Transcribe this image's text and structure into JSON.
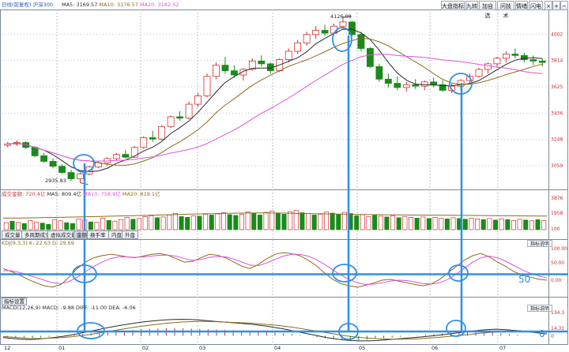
{
  "toolbar": {
    "title_prefix": "日线(前复权)",
    "code": "沪深300",
    "buttons": [
      "大盘指标",
      "九转",
      "加自选",
      "问技术",
      "情绪",
      "闪电"
    ],
    "win_buttons": [
      "×",
      "+",
      "−"
    ]
  },
  "price_header": {
    "ma5": "MA5: 3169.57",
    "ma10": "MA10: 3176.57",
    "ma20": "MA20: 3182.52"
  },
  "volume_header": {
    "vol": "成交金额: 720.4亿",
    "ma5": "MA5: 809.4亿",
    "ma10": "MA10: 758.9亿",
    "ma20": "MA20: 819.1亿"
  },
  "sub_tabs": [
    "成交量",
    "多周期成交量",
    "虚拟成交量",
    "金额",
    "换手率",
    "内盘",
    "外盘"
  ],
  "active_sub_tab": "金额",
  "kdj_header": "KDJ(9,3,3) K: 22.63  D: 29.69",
  "macd_header": "MACD(12,26,9) MACD: -9.88  DIFF: -11.00  DEA: -6.06",
  "macd_tab": "指标设置",
  "indicator_buttons": [
    "指标说明",
    "指标说明"
  ],
  "overlay_labels": {
    "kdj_level": "50",
    "macd_level": "0"
  },
  "annotations": {
    "low": "2935.83",
    "high": "4126.09"
  },
  "colors": {
    "up": "#d32f2f",
    "down": "#1b8a1b",
    "ma5": "#2a2a2a",
    "ma10": "#8a6d1a",
    "ma20": "#e052d8",
    "annotation": "#2f8fe6",
    "axis_text": "#cc2b2b",
    "grid": "#b7c0cc"
  },
  "chart_data": [
    {
      "type": "candlestick",
      "title": "沪深300 日线",
      "x_ticks": [
        "12",
        "01",
        "02",
        "03",
        "04",
        "05",
        "06",
        "07"
      ],
      "y_ticks": [
        4002,
        3814,
        3625,
        3436,
        3248,
        3059
      ],
      "ylim": [
        2900,
        4180
      ],
      "candles": [
        {
          "o": 3205,
          "h": 3230,
          "l": 3190,
          "c": 3215
        },
        {
          "o": 3215,
          "h": 3240,
          "l": 3200,
          "c": 3225
        },
        {
          "o": 3225,
          "h": 3235,
          "l": 3180,
          "c": 3190
        },
        {
          "o": 3190,
          "h": 3200,
          "l": 3120,
          "c": 3130
        },
        {
          "o": 3130,
          "h": 3150,
          "l": 3080,
          "c": 3090
        },
        {
          "o": 3090,
          "h": 3110,
          "l": 3040,
          "c": 3055
        },
        {
          "o": 3055,
          "h": 3070,
          "l": 3000,
          "c": 3010
        },
        {
          "o": 3010,
          "h": 3030,
          "l": 2950,
          "c": 2965
        },
        {
          "o": 2965,
          "h": 3010,
          "l": 2936,
          "c": 3000
        },
        {
          "o": 3000,
          "h": 3060,
          "l": 2990,
          "c": 3050
        },
        {
          "o": 3050,
          "h": 3090,
          "l": 3040,
          "c": 3080
        },
        {
          "o": 3080,
          "h": 3120,
          "l": 3060,
          "c": 3110
        },
        {
          "o": 3110,
          "h": 3150,
          "l": 3100,
          "c": 3140
        },
        {
          "o": 3140,
          "h": 3170,
          "l": 3110,
          "c": 3120
        },
        {
          "o": 3120,
          "h": 3200,
          "l": 3115,
          "c": 3190
        },
        {
          "o": 3190,
          "h": 3270,
          "l": 3180,
          "c": 3260
        },
        {
          "o": 3260,
          "h": 3310,
          "l": 3230,
          "c": 3250
        },
        {
          "o": 3250,
          "h": 3350,
          "l": 3240,
          "c": 3340
        },
        {
          "o": 3340,
          "h": 3420,
          "l": 3330,
          "c": 3410
        },
        {
          "o": 3410,
          "h": 3450,
          "l": 3380,
          "c": 3400
        },
        {
          "o": 3400,
          "h": 3520,
          "l": 3390,
          "c": 3500
        },
        {
          "o": 3500,
          "h": 3580,
          "l": 3480,
          "c": 3560
        },
        {
          "o": 3560,
          "h": 3720,
          "l": 3550,
          "c": 3700
        },
        {
          "o": 3700,
          "h": 3800,
          "l": 3680,
          "c": 3780
        },
        {
          "o": 3780,
          "h": 3840,
          "l": 3720,
          "c": 3740
        },
        {
          "o": 3740,
          "h": 3780,
          "l": 3690,
          "c": 3710
        },
        {
          "o": 3710,
          "h": 3760,
          "l": 3670,
          "c": 3750
        },
        {
          "o": 3750,
          "h": 3830,
          "l": 3740,
          "c": 3810
        },
        {
          "o": 3810,
          "h": 3850,
          "l": 3770,
          "c": 3790
        },
        {
          "o": 3790,
          "h": 3800,
          "l": 3720,
          "c": 3740
        },
        {
          "o": 3740,
          "h": 3830,
          "l": 3730,
          "c": 3820
        },
        {
          "o": 3820,
          "h": 3900,
          "l": 3800,
          "c": 3880
        },
        {
          "o": 3880,
          "h": 3960,
          "l": 3860,
          "c": 3940
        },
        {
          "o": 3940,
          "h": 4020,
          "l": 3920,
          "c": 4000
        },
        {
          "o": 4000,
          "h": 4060,
          "l": 3970,
          "c": 4030
        },
        {
          "o": 4030,
          "h": 4070,
          "l": 3990,
          "c": 4010
        },
        {
          "o": 4010,
          "h": 4080,
          "l": 4000,
          "c": 4060
        },
        {
          "o": 4060,
          "h": 4126,
          "l": 4040,
          "c": 4090
        },
        {
          "o": 4090,
          "h": 4100,
          "l": 3990,
          "c": 4000
        },
        {
          "o": 4000,
          "h": 4020,
          "l": 3880,
          "c": 3900
        },
        {
          "o": 3900,
          "h": 3910,
          "l": 3760,
          "c": 3770
        },
        {
          "o": 3770,
          "h": 3790,
          "l": 3660,
          "c": 3680
        },
        {
          "o": 3680,
          "h": 3720,
          "l": 3620,
          "c": 3650
        },
        {
          "o": 3650,
          "h": 3700,
          "l": 3600,
          "c": 3620
        },
        {
          "o": 3620,
          "h": 3660,
          "l": 3590,
          "c": 3640
        },
        {
          "o": 3640,
          "h": 3680,
          "l": 3610,
          "c": 3630
        },
        {
          "o": 3630,
          "h": 3670,
          "l": 3600,
          "c": 3660
        },
        {
          "o": 3660,
          "h": 3690,
          "l": 3620,
          "c": 3640
        },
        {
          "o": 3640,
          "h": 3670,
          "l": 3590,
          "c": 3600
        },
        {
          "o": 3600,
          "h": 3650,
          "l": 3580,
          "c": 3630
        },
        {
          "o": 3630,
          "h": 3680,
          "l": 3610,
          "c": 3670
        },
        {
          "o": 3670,
          "h": 3720,
          "l": 3650,
          "c": 3700
        },
        {
          "o": 3700,
          "h": 3760,
          "l": 3690,
          "c": 3750
        },
        {
          "o": 3750,
          "h": 3800,
          "l": 3720,
          "c": 3790
        },
        {
          "o": 3790,
          "h": 3840,
          "l": 3770,
          "c": 3830
        },
        {
          "o": 3830,
          "h": 3880,
          "l": 3800,
          "c": 3860
        },
        {
          "o": 3860,
          "h": 3900,
          "l": 3830,
          "c": 3850
        },
        {
          "o": 3850,
          "h": 3870,
          "l": 3800,
          "c": 3820
        },
        {
          "o": 3820,
          "h": 3850,
          "l": 3780,
          "c": 3810
        },
        {
          "o": 3810,
          "h": 3830,
          "l": 3770,
          "c": 3800
        }
      ]
    },
    {
      "type": "bar",
      "title": "成交金额",
      "y_ticks": [
        3876,
        1958,
        100
      ],
      "ylim": [
        0,
        4200
      ],
      "values": [
        900,
        1100,
        950,
        800,
        1200,
        1000,
        850,
        700,
        1300,
        1150,
        900,
        800,
        1400,
        1250,
        1000,
        950,
        1500,
        1200,
        1100,
        1300,
        1600,
        1350,
        1450,
        1700,
        1800,
        1550,
        1650,
        1900,
        2100,
        1700,
        1600,
        1800,
        1750,
        2000,
        1900,
        2050,
        2200,
        1950,
        1850,
        2000,
        2300,
        2100,
        1900,
        2250,
        2400,
        2150,
        2000,
        2350,
        2500,
        2200,
        2100,
        1900,
        2000,
        2300,
        2150,
        1950,
        2250,
        2100,
        1800,
        1950,
        1700,
        1850,
        1750,
        1650,
        1800,
        1550,
        1700,
        1600,
        1500,
        1650,
        1450,
        1600,
        1500,
        1400,
        1550,
        1450,
        1350,
        1500,
        1400,
        1300,
        1450,
        1250,
        1400,
        1300,
        1200,
        1350,
        1250,
        1150,
        1300,
        1200
      ],
      "up": [
        1,
        0,
        1,
        0,
        1,
        1,
        0,
        0,
        1,
        1,
        0,
        0,
        1,
        1,
        0,
        1,
        1,
        0,
        1,
        1,
        1,
        0,
        1,
        1,
        1,
        0,
        1,
        1,
        1,
        0,
        0,
        1,
        0,
        1,
        0,
        1,
        1,
        0,
        0,
        1,
        1,
        0,
        0,
        1,
        1,
        0,
        0,
        1,
        1,
        0,
        1,
        0,
        1,
        1,
        0,
        0,
        1,
        0,
        0,
        1,
        1,
        0,
        1,
        0,
        1,
        0,
        1,
        1,
        0,
        1,
        0,
        1,
        1,
        0,
        1,
        0,
        0,
        1,
        1,
        0,
        1,
        0,
        1,
        0,
        1,
        1,
        0,
        1,
        0,
        1
      ],
      "ma": [
        1500,
        1520,
        1560,
        1600,
        1650,
        1700,
        1760,
        1820,
        1880,
        1950,
        2020,
        2080,
        2120,
        2160,
        2180,
        2150,
        2100,
        2060,
        2020,
        1980,
        1950,
        1920,
        1900,
        1880,
        1860,
        1840,
        1820,
        1800,
        1780,
        1760
      ]
    },
    {
      "type": "line",
      "title": "KDJ(9,3,3)",
      "y_ticks": [
        100,
        50,
        0
      ],
      "ylim": [
        -5,
        105
      ],
      "series": [
        {
          "name": "K",
          "values": [
            55,
            48,
            40,
            30,
            22,
            15,
            12,
            18,
            35,
            55,
            70,
            80,
            85,
            88,
            86,
            82,
            80,
            84,
            88,
            90,
            86,
            78,
            70,
            72,
            80,
            88,
            86,
            80,
            70,
            60,
            55,
            65,
            78,
            88,
            92,
            90,
            85,
            75,
            62,
            45,
            30,
            20,
            15,
            12,
            16,
            22,
            28,
            30,
            26,
            22,
            18,
            15,
            20,
            30,
            45,
            60,
            75,
            85,
            90,
            82,
            70,
            60,
            48,
            40,
            35,
            30,
            28
          ]
        },
        {
          "name": "D",
          "values": [
            50,
            50,
            46,
            40,
            34,
            28,
            22,
            20,
            25,
            35,
            48,
            60,
            70,
            78,
            82,
            82,
            81,
            82,
            84,
            86,
            86,
            84,
            78,
            74,
            76,
            81,
            83,
            82,
            77,
            70,
            63,
            62,
            68,
            76,
            84,
            88,
            88,
            84,
            76,
            65,
            52,
            40,
            30,
            22,
            18,
            19,
            22,
            26,
            28,
            27,
            24,
            20,
            19,
            22,
            30,
            42,
            56,
            70,
            80,
            84,
            80,
            72,
            62,
            52,
            44,
            38,
            33
          ]
        }
      ]
    },
    {
      "type": "bar",
      "title": "MACD(12,26,9)",
      "y_ticks": [
        134.3,
        14.31,
        0
      ],
      "ylim": [
        -35,
        140
      ],
      "values": [
        -5,
        -8,
        -10,
        -12,
        -10,
        -6,
        -2,
        2,
        6,
        10,
        14,
        18,
        22,
        26,
        30,
        34,
        38,
        40,
        42,
        44,
        45,
        44,
        42,
        40,
        38,
        36,
        34,
        32,
        30,
        28,
        26,
        22,
        18,
        14,
        10,
        4,
        -2,
        -8,
        -14,
        -20,
        -25,
        -28,
        -26,
        -22,
        -18,
        -14,
        -10,
        -6,
        -2,
        2,
        6,
        10,
        14,
        18,
        20,
        22,
        24,
        22,
        18,
        14,
        10,
        6,
        2,
        -2,
        -6
      ],
      "series": [
        {
          "name": "DIFF",
          "values": [
            -10,
            -15,
            -20,
            -22,
            -20,
            -15,
            -10,
            -4,
            4,
            14,
            24,
            34,
            44,
            54,
            62,
            70,
            78,
            84,
            88,
            92,
            95,
            96,
            95,
            92,
            88,
            84,
            80,
            76,
            72,
            68,
            62,
            56,
            48,
            40,
            30,
            20,
            10,
            0,
            -10,
            -18,
            -24,
            -28,
            -30,
            -30,
            -28,
            -24,
            -20,
            -16,
            -12,
            -8,
            -3,
            2,
            8,
            14,
            20,
            26,
            32,
            36,
            38,
            36,
            32,
            28,
            22,
            16,
            10
          ]
        },
        {
          "name": "DEA",
          "values": [
            -5,
            -8,
            -12,
            -15,
            -16,
            -15,
            -13,
            -10,
            -6,
            0,
            6,
            14,
            22,
            30,
            38,
            46,
            54,
            60,
            66,
            72,
            76,
            80,
            82,
            84,
            84,
            82,
            80,
            78,
            76,
            74,
            70,
            66,
            62,
            56,
            50,
            42,
            34,
            26,
            18,
            10,
            2,
            -5,
            -10,
            -14,
            -17,
            -19,
            -20,
            -20,
            -19,
            -17,
            -14,
            -10,
            -6,
            -2,
            3,
            8,
            14,
            18,
            22,
            25,
            26,
            26,
            24,
            22,
            20
          ]
        }
      ]
    }
  ]
}
